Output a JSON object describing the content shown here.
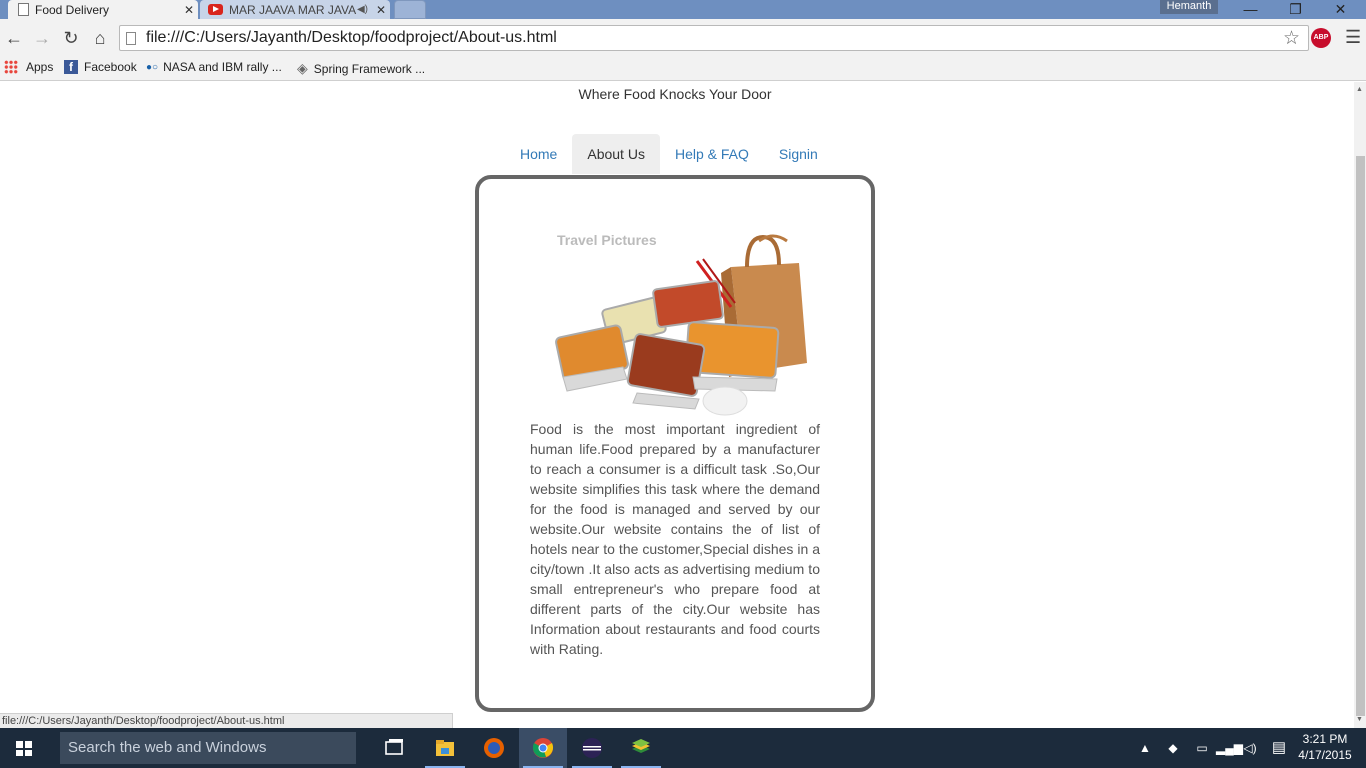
{
  "browser": {
    "tabs": [
      {
        "title": "Food Delivery",
        "active": true
      },
      {
        "title": "MAR JAAVA MAR JAVA",
        "active": false,
        "audio": true
      }
    ],
    "user": "Hemanth",
    "url": "file:///C:/Users/Jayanth/Desktop/foodproject/About-us.html",
    "bookmarks": [
      {
        "label": "Apps",
        "icon": "apps-grid-icon"
      },
      {
        "label": "Facebook",
        "icon": "facebook-icon"
      },
      {
        "label": "NASA and IBM rally ...",
        "icon": "nasa-icon"
      },
      {
        "label": "Spring Framework ...",
        "icon": "spring-icon"
      }
    ],
    "extension": "ABP",
    "status_url": "file:///C:/Users/Jayanth/Desktop/foodproject/About-us.html"
  },
  "page": {
    "tagline": "Where Food Knocks Your Door",
    "nav": [
      {
        "label": "Home",
        "active": false
      },
      {
        "label": "About Us",
        "active": true
      },
      {
        "label": "Help & FAQ",
        "active": false
      },
      {
        "label": "Signin",
        "active": false
      }
    ],
    "image_watermark": "Travel Pictures",
    "about_text": "Food is the most important ingredient of human life.Food prepared by a manufacturer to reach a consumer is a difficult task .So,Our website simplifies this task where the demand for the food is managed and served by our website.Our website contains the of list of hotels near to the customer,Special dishes in a city/town .It also acts as advertising medium to small entrepreneur's who prepare food at different parts of the city.Our website has Information about restaurants and food courts with Rating."
  },
  "taskbar": {
    "search_placeholder": "Search the web and Windows",
    "apps": [
      "task-view-icon",
      "file-explorer-icon",
      "firefox-icon",
      "chrome-icon",
      "eclipse-icon",
      "bluestacks-icon"
    ],
    "time": "3:21 PM",
    "date": "4/17/2015"
  },
  "colors": {
    "link": "#337ab7",
    "active_tab_bg": "#eeeeee",
    "card_border": "#666666",
    "taskbar_bg": "#1c2b3c"
  }
}
